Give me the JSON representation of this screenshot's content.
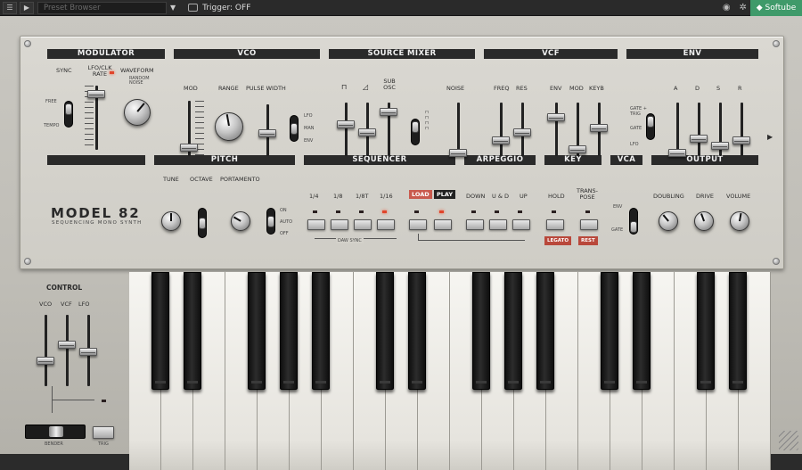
{
  "topbar": {
    "preset_placeholder": "Preset Browser",
    "trigger_label": "Trigger: OFF",
    "brand": "Softube"
  },
  "sections": {
    "modulator": "MODULATOR",
    "vco": "VCO",
    "source_mixer": "SOURCE MIXER",
    "vcf": "VCF",
    "env": "ENV",
    "pitch": "PITCH",
    "sequencer": "SEQUENCER",
    "arpeggio": "ARPEGGIO",
    "key": "KEY",
    "vca": "VCA",
    "output": "OUTPUT"
  },
  "labels": {
    "sync": "SYNC",
    "lfo_rate": "LFO/CLK RATE",
    "waveform": "WAVEFORM",
    "random_noise": "RANDOM\nNOISE",
    "free": "FREE",
    "tempo": "TEMPO",
    "mod": "MOD",
    "range": "RANGE",
    "pulse_width": "PULSE WIDTH",
    "lfo": "LFO",
    "man": "MAN",
    "env": "ENV",
    "sub_osc": "SUB OSC",
    "noise": "NOISE",
    "freq": "FREQ",
    "res": "RES",
    "vcf_env": "ENV",
    "vcf_mod": "MOD",
    "keyb": "KEYB",
    "a": "A",
    "d": "D",
    "s": "S",
    "r": "R",
    "gate_trig": "GATE + TRIG",
    "gate": "GATE",
    "env_lfo": "LFO",
    "tune": "TUNE",
    "octave": "OCTAVE",
    "portamento": "PORTAMENTO",
    "on": "ON",
    "auto": "AUTO",
    "off": "OFF",
    "q14": "1/4",
    "q18": "1/8",
    "q18t": "1/8T",
    "q116": "1/16",
    "load": "LOAD",
    "play": "PLAY",
    "daw_sync": "DAW SYNC",
    "down": "DOWN",
    "ugd": "U & D",
    "up": "UP",
    "hold": "HOLD",
    "transpose": "TRANS-\nPOSE",
    "legato": "LEGATO",
    "rest": "REST",
    "vca_env": "ENV",
    "vca_gate": "GATE",
    "doubling": "DOUBLING",
    "drive": "DRIVE",
    "volume": "VOLUME",
    "control": "CONTROL",
    "c_vco": "VCO",
    "c_vcf": "VCF",
    "c_lfo": "LFO",
    "bender": "BENDER",
    "trig": "TRIG"
  },
  "model": {
    "name": "MODEL 82",
    "subtitle": "SEQUENCING MONO SYNTH"
  },
  "leds": {
    "lfo_rate": "on",
    "seq_116": "on",
    "seq_rec": "on"
  }
}
